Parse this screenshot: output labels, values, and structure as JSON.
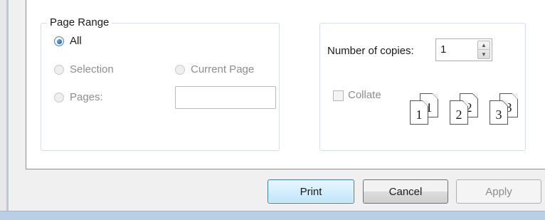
{
  "page_range": {
    "legend": "Page Range",
    "all_label": "All",
    "selection_label": "Selection",
    "current_page_label": "Current Page",
    "pages_label": "Pages:",
    "pages_value": "",
    "selected": "All"
  },
  "copies": {
    "label": "Number of copies:",
    "value": "1",
    "collate_label": "Collate",
    "collate_checked": false,
    "collate_icons": [
      {
        "front": "1",
        "back": "1"
      },
      {
        "front": "2",
        "back": "2"
      },
      {
        "front": "3",
        "back": "3"
      }
    ]
  },
  "buttons": {
    "print": "Print",
    "cancel": "Cancel",
    "apply": "Apply"
  },
  "colors": {
    "accent": "#3c7fb1",
    "window_frame": "#b9cfe6"
  }
}
